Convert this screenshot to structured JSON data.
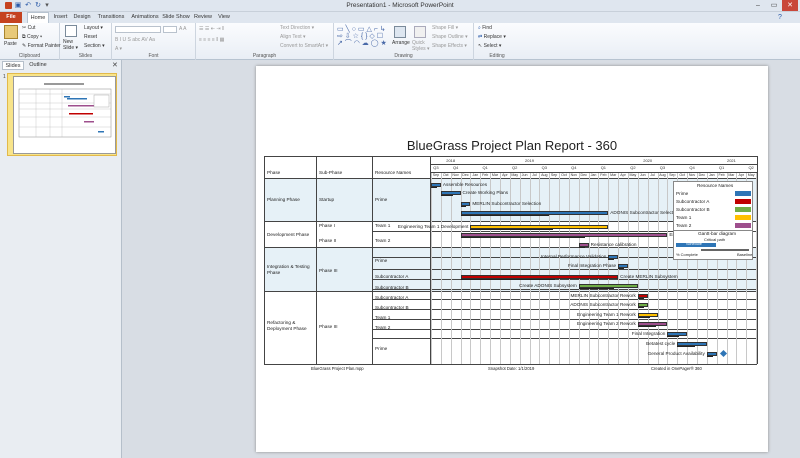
{
  "window": {
    "title": "Presentation1 - Microsoft PowerPoint",
    "controls": [
      "–",
      "▭",
      "✕"
    ]
  },
  "tabs": [
    "File",
    "Home",
    "Insert",
    "Design",
    "Transitions",
    "Animations",
    "Slide Show",
    "Review",
    "View"
  ],
  "ribbon": {
    "clipboard": {
      "label": "Clipboard",
      "paste": "Paste",
      "cut": "Cut",
      "copy": "Copy ▾",
      "format_painter": "Format Painter"
    },
    "slides": {
      "label": "Slides",
      "new_slide": "New Slide ▾",
      "layout": "Layout ▾",
      "reset": "Reset",
      "section": "Section ▾"
    },
    "font": {
      "label": "Font"
    },
    "paragraph": {
      "label": "Paragraph",
      "text_direction": "Text Direction ▾",
      "align_text": "Align Text ▾",
      "convert_smartart": "Convert to SmartArt ▾"
    },
    "drawing": {
      "label": "Drawing",
      "arrange": "Arrange",
      "quick_styles": "Quick Styles ▾",
      "shape_fill": "Shape Fill ▾",
      "shape_outline": "Shape Outline ▾",
      "shape_effects": "Shape Effects ▾"
    },
    "editing": {
      "label": "Editing",
      "find": "Find",
      "replace": "Replace ▾",
      "select": "Select ▾"
    }
  },
  "pane": {
    "tabs": [
      "Slides",
      "Outline"
    ],
    "close": "✕",
    "slide_number": "1"
  },
  "slide": {
    "title": "BlueGrass Project Plan Report - 360",
    "headers": {
      "phase": "Phase",
      "subphase": "Sub-Phase",
      "resource": "Resource Names"
    },
    "years": [
      "2018",
      "2019",
      "2020",
      "2021"
    ],
    "quarters": [
      "Q3",
      "Q4",
      "Q1",
      "Q2",
      "Q3",
      "Q4",
      "Q1",
      "Q2",
      "Q3",
      "Q4",
      "Q1",
      "Q2"
    ],
    "months": [
      "Sep",
      "Oct",
      "Nov",
      "Dec",
      "Jan",
      "Feb",
      "Mar",
      "Apr",
      "May",
      "Jun",
      "Jul",
      "Aug",
      "Sep",
      "Oct",
      "Nov",
      "Dec",
      "Jan",
      "Feb",
      "Mar",
      "Apr",
      "May",
      "Jun",
      "Jul",
      "Aug",
      "Sep",
      "Oct",
      "Nov",
      "Dec",
      "Jan",
      "Feb",
      "Mar",
      "Apr",
      "May"
    ],
    "phases": [
      "Planning Phase",
      "Development Phase",
      "Integration & Testing Phase",
      "Refactoring & Deployment Phase"
    ],
    "subphases": [
      "Startup",
      "Phase I",
      "Phase II",
      "Phase III",
      "Phase III"
    ],
    "resources": [
      "Prime",
      "Team 1",
      "Team 2",
      "Prime",
      "Subcontractor A",
      "Subcontractor B",
      "Subcontractor A",
      "Subcontractor B",
      "Team 1",
      "Team 2",
      "Prime"
    ],
    "tasks": [
      "Assemble Resources",
      "Create Working Plans",
      "MERLIN Subcontractor Selection",
      "ADONIS Subcontractor Selection",
      "Engineering Team 1 Development",
      "Engineering Team 2 Development",
      "Resistance calibration",
      "Internal Performance Validation",
      "Final Integration Phase",
      "Create MERLIN Subsystem",
      "Create ADONIS Subsystem",
      "MERLIN Subcontractor Rework",
      "ADONIS Subcontractor Rework",
      "Engineering Team 1 Rework",
      "Engineering Team 2 Rework",
      "Final Integration",
      "Betatest cycle",
      "General Product Availability"
    ],
    "legend": {
      "title": "Resource Names",
      "items": [
        {
          "name": "Prime",
          "color": "#2e75b6"
        },
        {
          "name": "Subcontractor A",
          "color": "#c00000"
        },
        {
          "name": "Subcontractor B",
          "color": "#70ad47"
        },
        {
          "name": "Team 1",
          "color": "#ffc000"
        },
        {
          "name": "Team 2",
          "color": "#9e4f8d"
        }
      ]
    },
    "gantt_legend": {
      "title": "Gantt-bar diagram",
      "critical": "Critical path",
      "schedule": "Schedule",
      "pct": "% Complete",
      "baseline": "Baseline"
    },
    "footer": {
      "file": "BlueGrass Project Plan.mpp",
      "snapshot": "Snapshot Date: 1/1/2019",
      "created": "Created in OnePager® 360"
    }
  }
}
